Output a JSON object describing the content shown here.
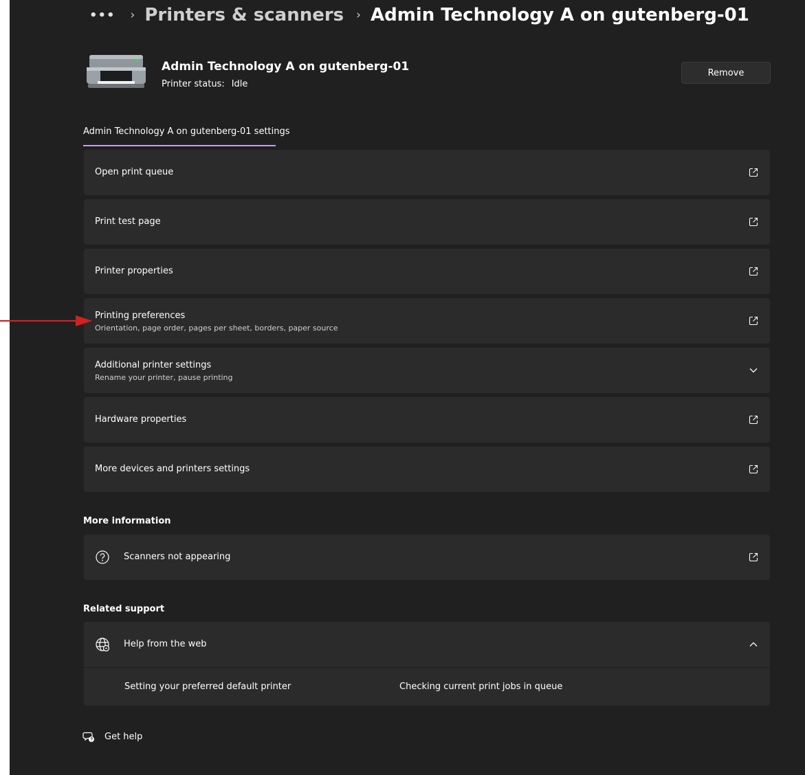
{
  "breadcrumb": {
    "overflow": "•••",
    "parent": "Printers & scanners",
    "current": "Admin Technology A on gutenberg-01"
  },
  "printer": {
    "name": "Admin Technology A on gutenberg-01",
    "status_label": "Printer status:",
    "status_value": "Idle",
    "remove_label": "Remove"
  },
  "settings_tab": {
    "label": "Admin Technology A on gutenberg-01 settings"
  },
  "settings": [
    {
      "title": "Open print queue",
      "subtitle": "",
      "icon": "external-link-icon"
    },
    {
      "title": "Print test page",
      "subtitle": "",
      "icon": "external-link-icon"
    },
    {
      "title": "Printer properties",
      "subtitle": "",
      "icon": "external-link-icon"
    },
    {
      "title": "Printing preferences",
      "subtitle": "Orientation, page order, pages per sheet, borders, paper source",
      "icon": "external-link-icon"
    },
    {
      "title": "Additional printer settings",
      "subtitle": "Rename your printer, pause printing",
      "icon": "chevron-down-icon"
    },
    {
      "title": "Hardware properties",
      "subtitle": "",
      "icon": "external-link-icon"
    },
    {
      "title": "More devices and printers settings",
      "subtitle": "",
      "icon": "external-link-icon"
    }
  ],
  "more_information": {
    "title": "More information",
    "item": {
      "title": "Scanners not appearing",
      "icon": "question-circle-icon"
    }
  },
  "related_support": {
    "title": "Related support",
    "help": {
      "title": "Help from the web",
      "icon": "globe-icon",
      "links": [
        "Setting your preferred default printer",
        "Checking current print jobs in queue"
      ]
    }
  },
  "get_help": {
    "label": "Get help",
    "icon": "help-chat-icon"
  },
  "colors": {
    "background": "#202020",
    "card": "#2b2b2b",
    "accent": "#c7a2e8",
    "annotation_arrow": "#d42020"
  }
}
